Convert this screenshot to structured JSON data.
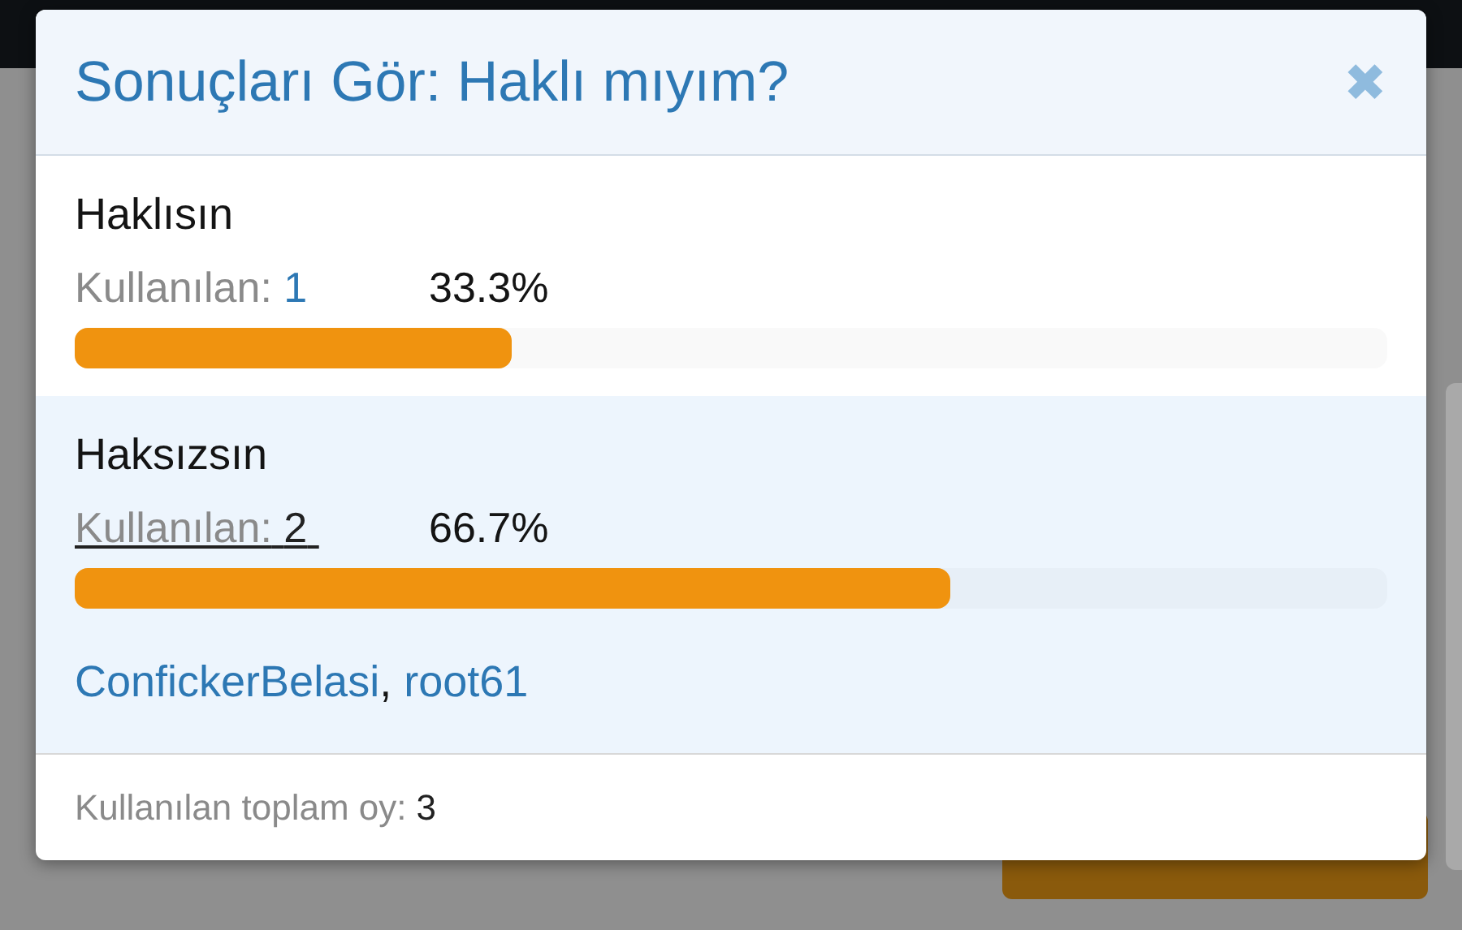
{
  "dialog": {
    "title": "Sonuçları Gör: Haklı mıyım?",
    "close_icon": "✖",
    "options": [
      {
        "label": "Haklısın",
        "count_label": "Kullanılan:",
        "count": "1",
        "percent": "33.3%",
        "level": 0.333,
        "expanded": false
      },
      {
        "label": "Haksızsın",
        "count_label": "Kullanılan:",
        "count": "2",
        "percent": "66.7%",
        "level": 0.667,
        "expanded": true,
        "voters": [
          "ConfickerBelasi",
          "root61"
        ],
        "separator": ","
      }
    ],
    "total_label": "Kullanılan toplam oy:",
    "total": "3"
  }
}
